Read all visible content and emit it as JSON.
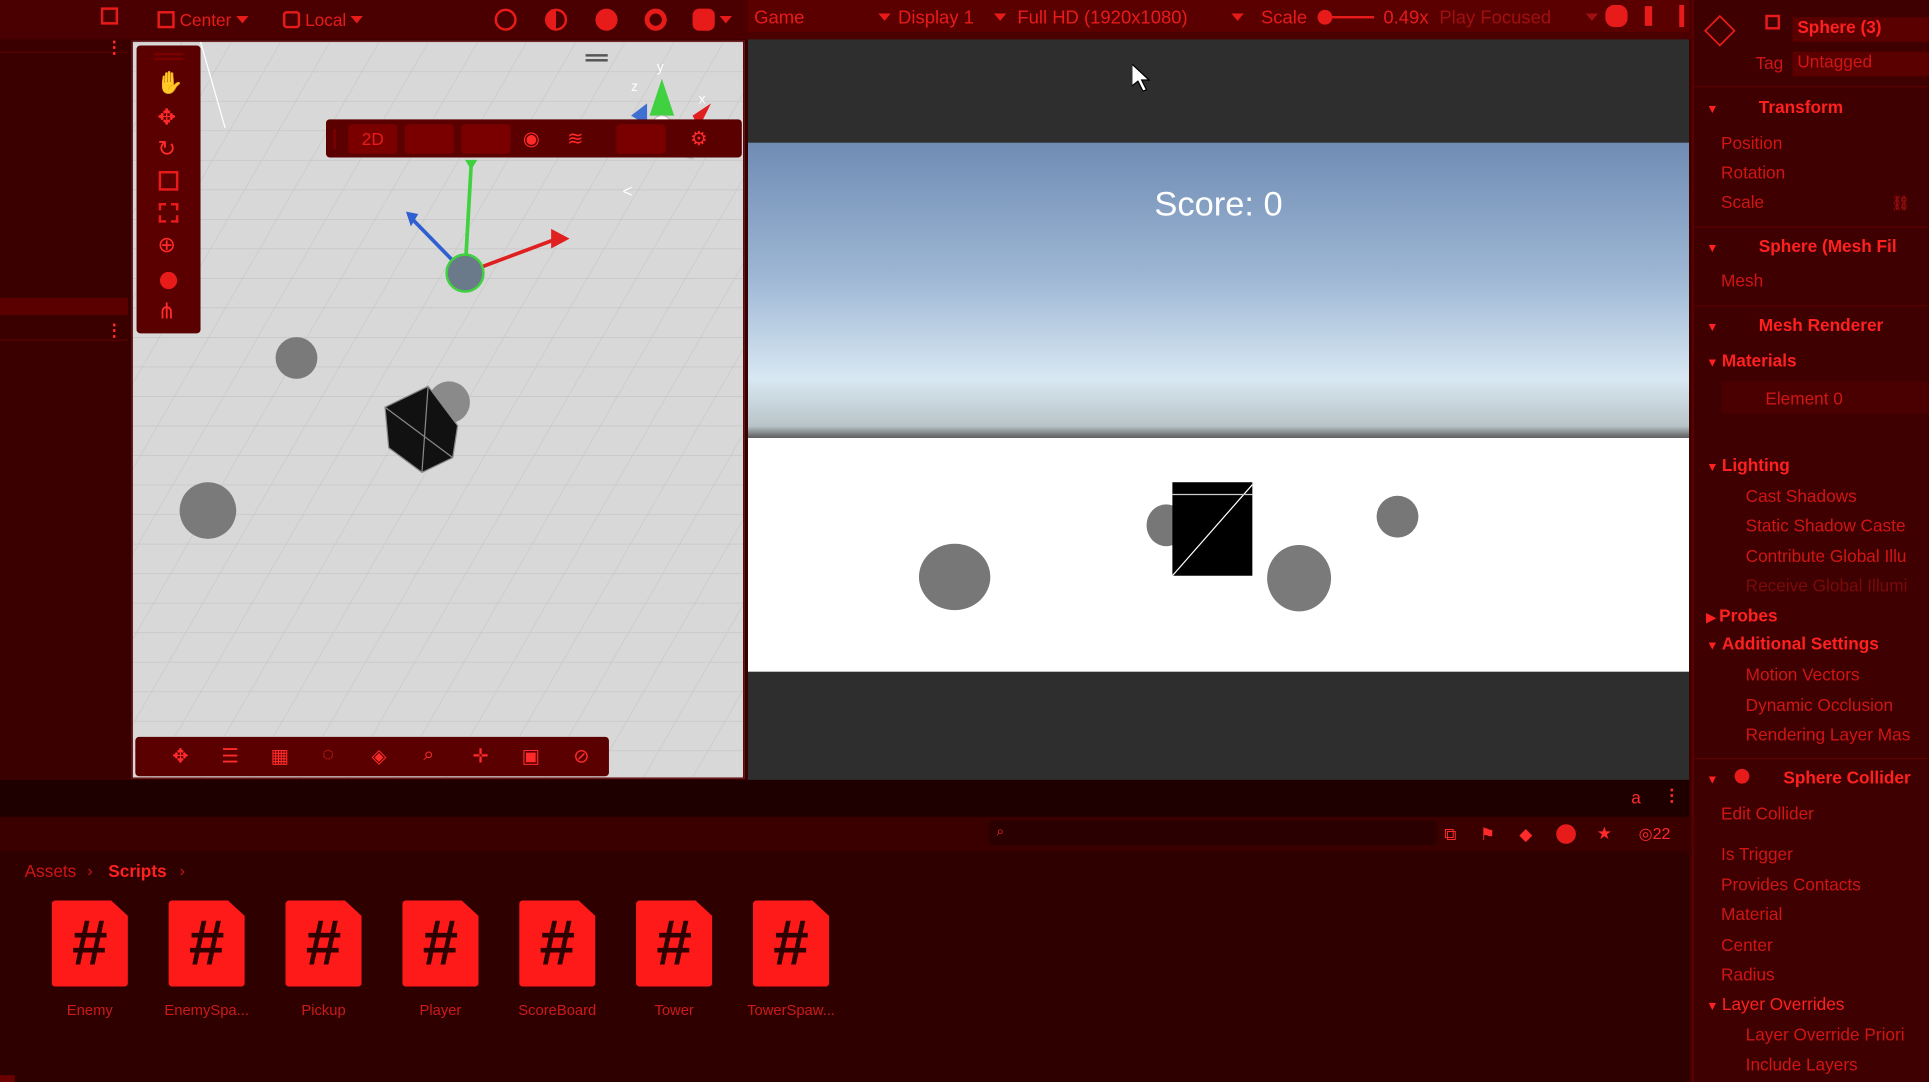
{
  "toolbar": {
    "pivot_label": "Center",
    "space_label": "Local"
  },
  "game_toolbar": {
    "view_label": "Game",
    "display_label": "Display 1",
    "resolution_label": "Full HD (1920x1080)",
    "scale_label": "Scale",
    "scale_value": "0.49x",
    "play_mode_label": "Play Focused"
  },
  "scene_view": {
    "mode_2d_label": "2D",
    "gizmo_axes": [
      "y",
      "z",
      "x"
    ]
  },
  "game_view": {
    "score_text": "Score: 0"
  },
  "inspector": {
    "object_name": "Sphere (3)",
    "tag_label": "Tag",
    "tag_value": "Untagged",
    "transform_title": "Transform",
    "transform_fields": [
      "Position",
      "Rotation",
      "Scale"
    ],
    "mesh_filter_title": "Sphere (Mesh Fil",
    "mesh_label": "Mesh",
    "mesh_renderer_title": "Mesh Renderer",
    "materials_label": "Materials",
    "element0_label": "Element 0",
    "lighting_label": "Lighting",
    "lighting_fields": [
      "Cast Shadows",
      "Static Shadow Caste",
      "Contribute Global Illu",
      "Receive Global Illumi"
    ],
    "probes_label": "Probes",
    "additional_label": "Additional Settings",
    "additional_fields": [
      "Motion Vectors",
      "Dynamic Occlusion",
      "Rendering Layer Mas"
    ],
    "collider_title": "Sphere Collider",
    "edit_collider_label": "Edit Collider",
    "collider_fields": [
      "Is Trigger",
      "Provides Contacts",
      "Material",
      "Center",
      "Radius"
    ],
    "layer_overrides_label": "Layer Overrides",
    "layer_fields": [
      "Layer Override Priori",
      "Include Layers"
    ]
  },
  "project": {
    "breadcrumb": [
      "Assets",
      "Scripts"
    ],
    "hidden_count": "22",
    "assets": [
      "Enemy",
      "EnemySpa...",
      "Pickup",
      "Player",
      "ScoreBoard",
      "Tower",
      "TowerSpaw..."
    ]
  },
  "colors": {
    "accent": "#ff1a1a",
    "panel": "#3a0000",
    "toolbar": "#4a0000"
  }
}
